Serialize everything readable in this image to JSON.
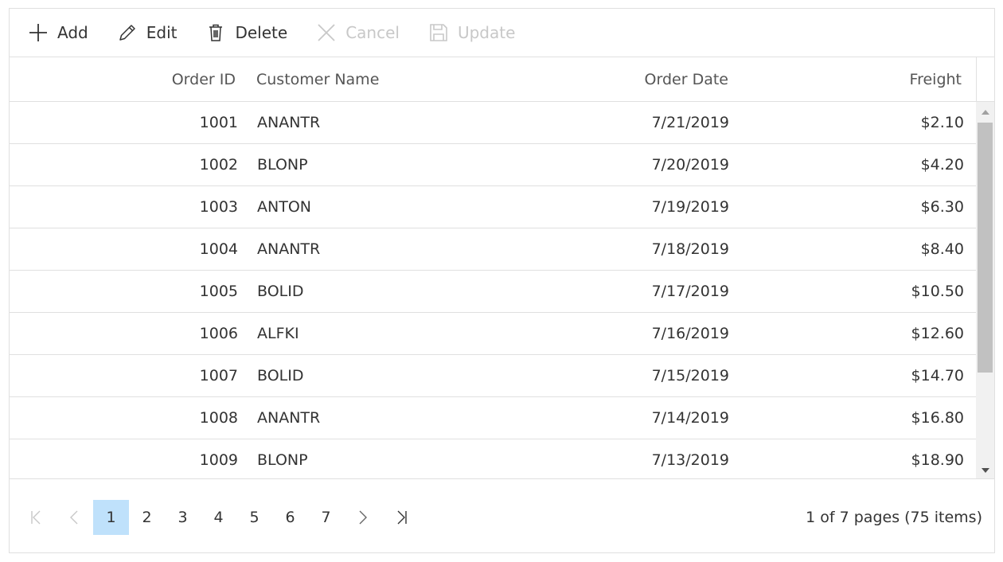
{
  "toolbar": {
    "add": {
      "label": "Add",
      "icon": "plus-icon",
      "enabled": true
    },
    "edit": {
      "label": "Edit",
      "icon": "pencil-icon",
      "enabled": true
    },
    "delete": {
      "label": "Delete",
      "icon": "trash-icon",
      "enabled": true
    },
    "cancel": {
      "label": "Cancel",
      "icon": "close-icon",
      "enabled": false
    },
    "update": {
      "label": "Update",
      "icon": "save-icon",
      "enabled": false
    }
  },
  "columns": {
    "order_id": "Order ID",
    "customer_name": "Customer Name",
    "order_date": "Order Date",
    "freight": "Freight"
  },
  "rows": [
    {
      "order_id": "1001",
      "customer_name": "ANANTR",
      "order_date": "7/21/2019",
      "freight": "$2.10"
    },
    {
      "order_id": "1002",
      "customer_name": "BLONP",
      "order_date": "7/20/2019",
      "freight": "$4.20"
    },
    {
      "order_id": "1003",
      "customer_name": "ANTON",
      "order_date": "7/19/2019",
      "freight": "$6.30"
    },
    {
      "order_id": "1004",
      "customer_name": "ANANTR",
      "order_date": "7/18/2019",
      "freight": "$8.40"
    },
    {
      "order_id": "1005",
      "customer_name": "BOLID",
      "order_date": "7/17/2019",
      "freight": "$10.50"
    },
    {
      "order_id": "1006",
      "customer_name": "ALFKI",
      "order_date": "7/16/2019",
      "freight": "$12.60"
    },
    {
      "order_id": "1007",
      "customer_name": "BOLID",
      "order_date": "7/15/2019",
      "freight": "$14.70"
    },
    {
      "order_id": "1008",
      "customer_name": "ANANTR",
      "order_date": "7/14/2019",
      "freight": "$16.80"
    },
    {
      "order_id": "1009",
      "customer_name": "BLONP",
      "order_date": "7/13/2019",
      "freight": "$18.90"
    }
  ],
  "pager": {
    "pages": [
      "1",
      "2",
      "3",
      "4",
      "5",
      "6",
      "7"
    ],
    "current_page": "1",
    "info": "1 of 7 pages (75 items)"
  },
  "colors": {
    "accent_current_page": "#bfe1fb",
    "border": "#e0e0e0",
    "disabled_text": "#c8c8c8",
    "scroll_thumb": "#c1c1c1"
  }
}
